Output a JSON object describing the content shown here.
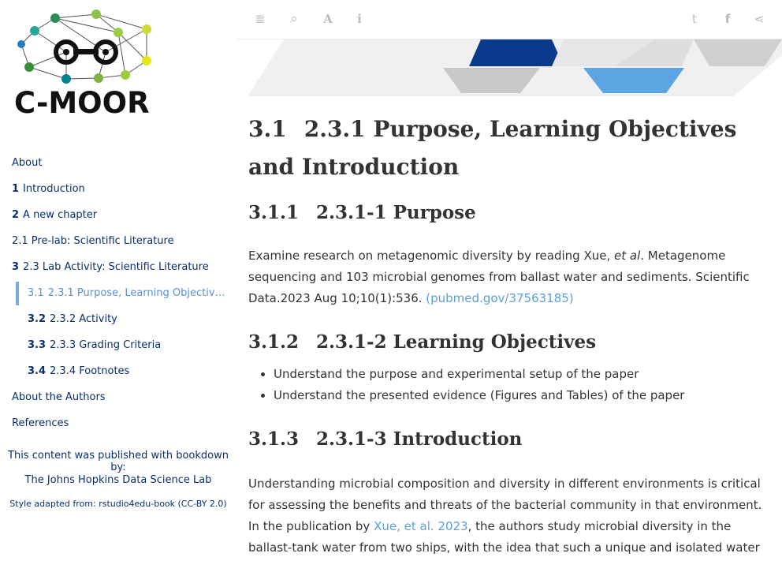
{
  "logo": {
    "text": "C-MOOR"
  },
  "toc": [
    {
      "num": "",
      "label": "About"
    },
    {
      "num": "1",
      "label": "Introduction"
    },
    {
      "num": "2",
      "label": "A new chapter"
    },
    {
      "num": "",
      "label": "2.1 Pre-lab: Scientific Literature"
    },
    {
      "num": "3",
      "label": "2.3 Lab Activity: Scientific Literature"
    },
    {
      "num": "3.1",
      "label": "2.3.1 Purpose, Learning Objectives ..."
    },
    {
      "num": "3.2",
      "label": "2.3.2 Activity"
    },
    {
      "num": "3.3",
      "label": "2.3.3 Grading Criteria"
    },
    {
      "num": "3.4",
      "label": "2.3.4 Footnotes"
    },
    {
      "num": "",
      "label": "About the Authors"
    },
    {
      "num": "",
      "label": "References"
    }
  ],
  "credits": {
    "line1": "This content was published with bookdown by:",
    "line2": "The Johns Hopkins Data Science Lab",
    "line3": "Style adapted from: rstudio4edu-book (CC-BY 2.0)"
  },
  "toolbar": {
    "toc_icon": "≣",
    "search_icon": "⌕",
    "font_icon": "A",
    "info_icon": "i",
    "twitter_icon": "t",
    "facebook_icon": "f",
    "share_icon": "⋖"
  },
  "content": {
    "h1_num": "3.1",
    "h1_text": "2.3.1 Purpose, Learning Objectives and Introduction",
    "s1_num": "3.1.1",
    "s1_text": "2.3.1-1 Purpose",
    "p1_a": "Examine research on metagenomic diversity by reading Xue, ",
    "p1_em": "et al",
    "p1_b": ". Metagenome sequencing and 103 microbial genomes from ballast water and sediments. Scientific Data.2023 Aug 10;10(1):536. ",
    "p1_link": "(pubmed.gov/37563185)",
    "s2_num": "3.1.2",
    "s2_text": "2.3.1-2 Learning Objectives",
    "bullets": [
      "Understand the purpose and experimental setup of the paper",
      "Understand the presented evidence (Figures and Tables) of the paper"
    ],
    "s3_num": "3.1.3",
    "s3_text": "2.3.1-3 Introduction",
    "p2_a": "Understanding microbial composition and diversity in different environments is critical for assessing the benefits and threats of the bacterial community in that environment. In the publication by ",
    "p2_link": "Xue, et al. 2023",
    "p2_b": ", the authors study microbial diversity in the ballast-tank water from two ships, with the idea that such a unique and isolated water"
  }
}
